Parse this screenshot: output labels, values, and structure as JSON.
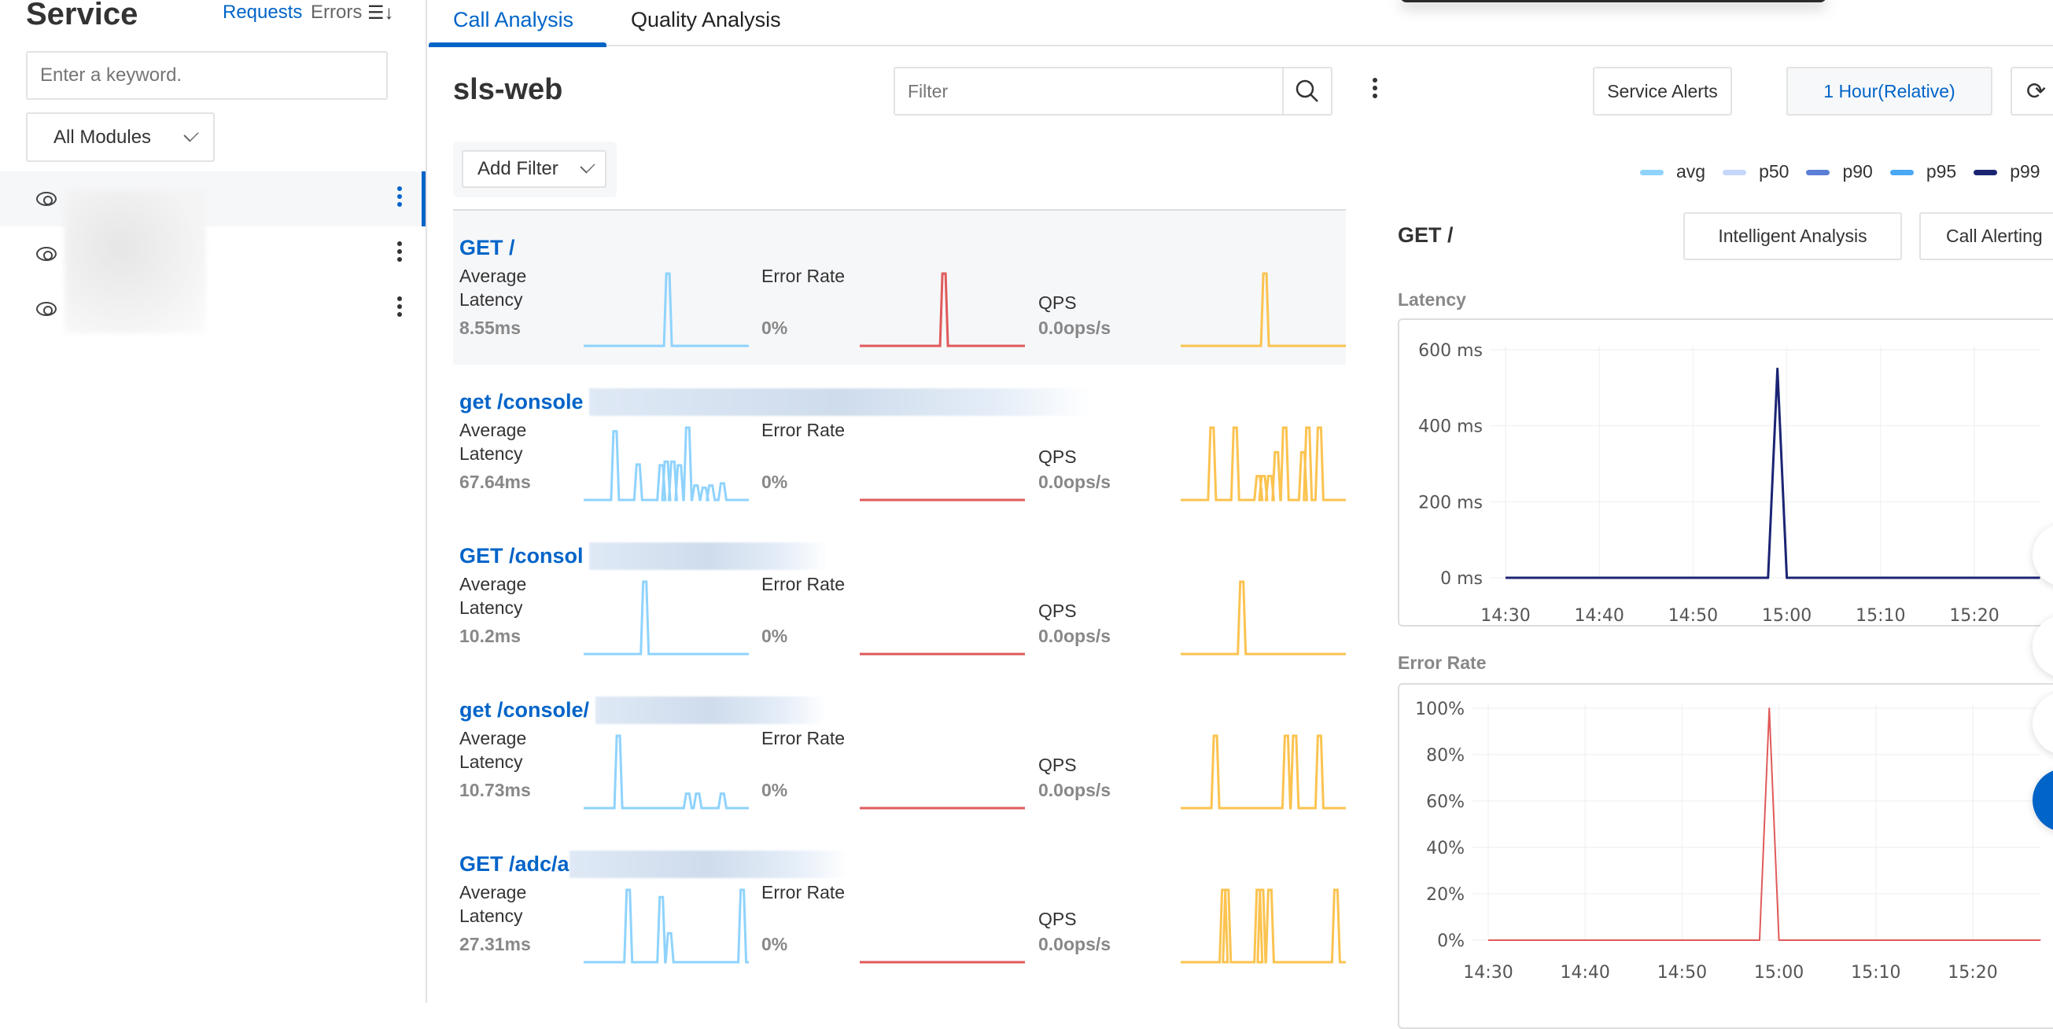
{
  "sidebar": {
    "title": "Service",
    "sort_requests": "Requests",
    "sort_errors": "Errors",
    "search_placeholder": "Enter a keyword.",
    "module_select": "All Modules",
    "items": [
      {
        "active": true
      },
      {
        "active": false
      },
      {
        "active": false
      }
    ]
  },
  "tabs": [
    {
      "label": "Call Analysis",
      "active": true
    },
    {
      "label": "Quality Analysis",
      "active": false
    }
  ],
  "header": {
    "service_name": "sls-web",
    "filter_placeholder": "Filter",
    "service_alerts": "Service Alerts",
    "time_range": "1 Hour(Relative)",
    "add_filter": "Add Filter"
  },
  "colors": {
    "accent": "#0064c8",
    "latency": "#8fd3fd",
    "error": "#e05a5a",
    "qps": "#fbc350",
    "p99": "#1b2473"
  },
  "calls": [
    {
      "title": "GET /",
      "latency_label": "Average Latency",
      "latency": "8.55ms",
      "error_label": "Error Rate",
      "error": "0%",
      "qps_label": "QPS",
      "qps": "0.0ops/s",
      "latency_spark": [
        [
          0.51,
          1
        ]
      ],
      "error_spark": [
        [
          0.51,
          1
        ]
      ],
      "qps_spark": [
        [
          0.51,
          1
        ]
      ]
    },
    {
      "title": "get /console",
      "latency_label": "Average Latency",
      "latency": "67.64ms",
      "error_label": "Error Rate",
      "error": "0%",
      "qps_label": "QPS",
      "qps": "0.0ops/s",
      "latency_spark": [
        [
          0.19,
          0.95
        ],
        [
          0.33,
          0.49
        ],
        [
          0.47,
          0.48
        ],
        [
          0.5,
          0.53
        ],
        [
          0.54,
          0.53
        ],
        [
          0.58,
          0.48
        ],
        [
          0.63,
          1
        ],
        [
          0.68,
          0.2
        ],
        [
          0.73,
          0.17
        ],
        [
          0.77,
          0.2
        ],
        [
          0.84,
          0.23
        ]
      ],
      "error_spark": [],
      "qps_spark": [
        [
          0.19,
          1
        ],
        [
          0.33,
          1
        ],
        [
          0.47,
          0.33
        ],
        [
          0.5,
          0.33
        ],
        [
          0.54,
          0.33
        ],
        [
          0.58,
          0.66
        ],
        [
          0.63,
          1
        ],
        [
          0.74,
          0.66
        ],
        [
          0.77,
          1
        ],
        [
          0.84,
          1
        ]
      ]
    },
    {
      "title": "GET /consol",
      "latency_label": "Average Latency",
      "latency": "10.2ms",
      "error_label": "Error Rate",
      "error": "0%",
      "qps_label": "QPS",
      "qps": "0.0ops/s",
      "latency_spark": [
        [
          0.37,
          1
        ]
      ],
      "error_spark": [],
      "qps_spark": [
        [
          0.37,
          1
        ]
      ]
    },
    {
      "title": "get /console/",
      "latency_label": "Average Latency",
      "latency": "10.73ms",
      "error_label": "Error Rate",
      "error": "0%",
      "qps_label": "QPS",
      "qps": "0.0ops/s",
      "latency_spark": [
        [
          0.21,
          1
        ],
        [
          0.63,
          0.2
        ],
        [
          0.69,
          0.2
        ],
        [
          0.84,
          0.2
        ]
      ],
      "error_spark": [],
      "qps_spark": [
        [
          0.21,
          1
        ],
        [
          0.64,
          1
        ],
        [
          0.69,
          1
        ],
        [
          0.84,
          1
        ]
      ]
    },
    {
      "title": "GET /adc/a",
      "latency_label": "Average Latency",
      "latency": "27.31ms",
      "error_label": "Error Rate",
      "error": "0%",
      "qps_label": "QPS",
      "qps": "0.0ops/s",
      "latency_spark": [
        [
          0.27,
          1
        ],
        [
          0.47,
          0.9
        ],
        [
          0.52,
          0.4
        ],
        [
          0.96,
          1
        ]
      ],
      "error_spark": [],
      "qps_spark": [
        [
          0.26,
          1
        ],
        [
          0.28,
          1
        ],
        [
          0.47,
          1
        ],
        [
          0.49,
          1
        ],
        [
          0.54,
          1
        ],
        [
          0.94,
          1
        ]
      ]
    }
  ],
  "detail": {
    "title": "GET /",
    "intelligent_analysis": "Intelligent Analysis",
    "call_alerting": "Call Alerting",
    "legend": [
      {
        "name": "avg",
        "color": "#8fd3fd"
      },
      {
        "name": "p50",
        "color": "#c5d8fb"
      },
      {
        "name": "p90",
        "color": "#5b7fd6"
      },
      {
        "name": "p95",
        "color": "#4aa8f5"
      },
      {
        "name": "p99",
        "color": "#1b2473"
      }
    ]
  },
  "chart_data": [
    {
      "type": "line",
      "title": "Latency",
      "x_ticks": [
        "14:30",
        "14:40",
        "14:50",
        "15:00",
        "15:10",
        "15:20"
      ],
      "y_ticks": [
        "0 ms",
        "200 ms",
        "400 ms",
        "600 ms"
      ],
      "ylim": [
        0,
        600
      ],
      "grid": true,
      "series": [
        {
          "name": "p99",
          "color": "#1b2473",
          "points": [
            [
              "14:30",
              0
            ],
            [
              "14:58",
              0
            ],
            [
              "14:59",
              550
            ],
            [
              "15:00",
              0
            ],
            [
              "15:27",
              0
            ]
          ]
        }
      ]
    },
    {
      "type": "line",
      "title": "Error Rate",
      "x_ticks": [
        "14:30",
        "14:40",
        "14:50",
        "15:00",
        "15:10",
        "15:20"
      ],
      "y_ticks": [
        "0%",
        "20%",
        "40%",
        "60%",
        "80%",
        "100%"
      ],
      "ylim": [
        0,
        100
      ],
      "grid": true,
      "series": [
        {
          "color": "#e05a5a",
          "points": [
            [
              "14:30",
              0
            ],
            [
              "14:58",
              0
            ],
            [
              "14:59",
              100
            ],
            [
              "15:00",
              0
            ],
            [
              "15:27",
              0
            ]
          ]
        }
      ]
    }
  ]
}
